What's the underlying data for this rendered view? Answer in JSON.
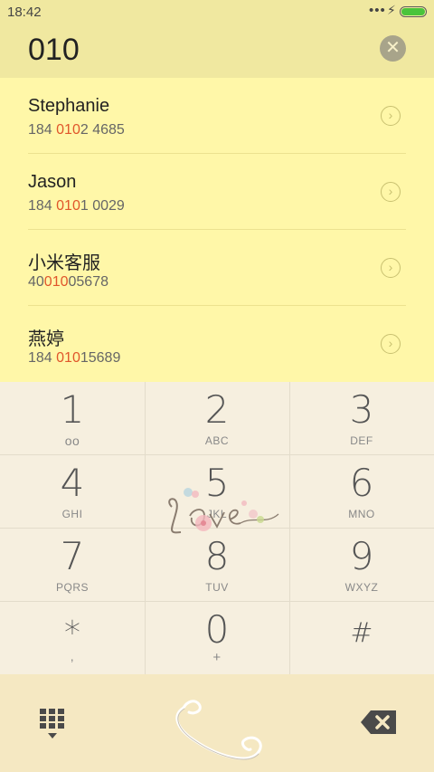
{
  "status_bar": {
    "time": "18:42",
    "signal_dots": "•••",
    "battery_level": 1.0,
    "battery_color": "#49c43b"
  },
  "search": {
    "query": "010",
    "clear_icon": "clear-circle-icon"
  },
  "results": [
    {
      "name": "Stephanie",
      "number_pre": "184 ",
      "number_hl": "010",
      "number_post": "2 4685"
    },
    {
      "name": "Jason",
      "number_pre": "184 ",
      "number_hl": "010",
      "number_post": "1 0029"
    },
    {
      "name": "小米客服",
      "number_pre": "40",
      "number_hl": "010",
      "number_post": "05678"
    },
    {
      "name": "燕婷",
      "number_pre": "184 ",
      "number_hl": "010",
      "number_post": "15689"
    }
  ],
  "highlight_color": "#e0562b",
  "keypad": [
    {
      "digit": "1",
      "sub": ""
    },
    {
      "digit": "2",
      "sub": "ABC"
    },
    {
      "digit": "3",
      "sub": "DEF"
    },
    {
      "digit": "4",
      "sub": "GHI"
    },
    {
      "digit": "5",
      "sub": "JKL"
    },
    {
      "digit": "6",
      "sub": "MNO"
    },
    {
      "digit": "7",
      "sub": "PQRS"
    },
    {
      "digit": "8",
      "sub": "TUV"
    },
    {
      "digit": "9",
      "sub": "WXYZ"
    },
    {
      "digit": "*",
      "sub": ","
    },
    {
      "digit": "0",
      "sub": "+"
    },
    {
      "digit": "#",
      "sub": ""
    }
  ],
  "bottom_bar": {
    "dialpad_icon": "dialpad-toggle-icon",
    "call_icon": "phone-call-icon",
    "backspace_icon": "backspace-icon"
  }
}
